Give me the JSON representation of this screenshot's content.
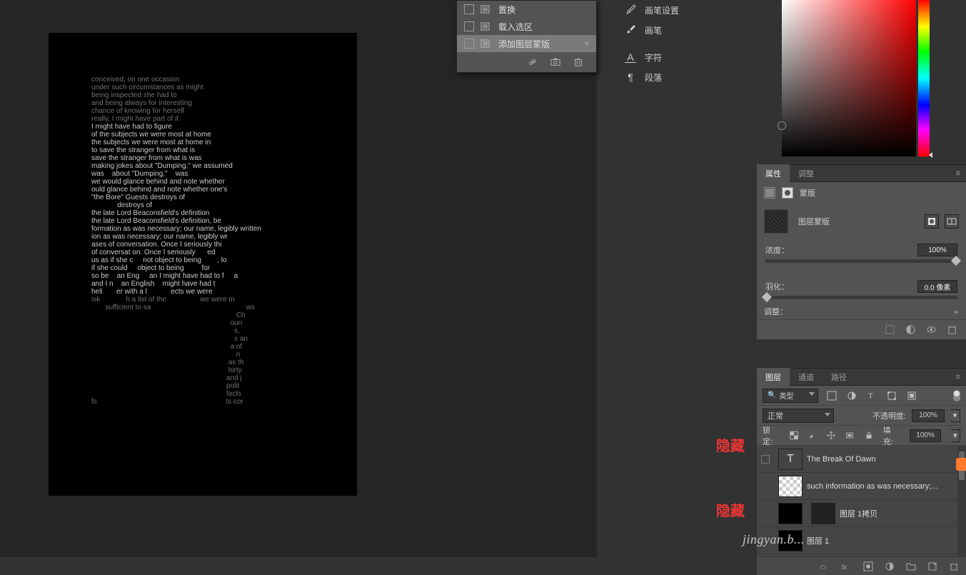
{
  "context_menu": {
    "items": [
      {
        "label": "置换"
      },
      {
        "label": "载入选区"
      },
      {
        "label": "添加图层蒙版"
      }
    ]
  },
  "right_list": {
    "items": [
      {
        "icon": "brush-settings",
        "label": "画笔设置"
      },
      {
        "icon": "brush",
        "label": "画笔"
      },
      {
        "icon": "character",
        "label": "字符"
      },
      {
        "icon": "paragraph",
        "label": "段落"
      }
    ]
  },
  "props": {
    "tabs": {
      "a": "属性",
      "b": "调整"
    },
    "mask_label": "蒙版",
    "mask_title": "图层蒙版",
    "density_label": "浓度：",
    "density_value": "100%",
    "feather_label": "羽化：",
    "feather_value": "0.0 像素",
    "refine_label": "调整："
  },
  "layers_panel": {
    "tabs": {
      "a": "图层",
      "b": "通道",
      "c": "路径"
    },
    "kind": "类型",
    "blend_mode": "正常",
    "opacity_label": "不透明度:",
    "opacity_value": "100%",
    "lock_label": "锁定:",
    "fill_label": "填充:",
    "fill_value": "100%",
    "layers": [
      {
        "name": "The Break Of Dawn",
        "type": "text"
      },
      {
        "name": "such information as was necessary;...",
        "type": "raster",
        "checker": true
      },
      {
        "name": "图层 1拷贝",
        "type": "raster"
      },
      {
        "name": "图层 1",
        "type": "smart"
      }
    ]
  },
  "annotations": {
    "hide1": "隐藏",
    "hide2": "隐藏"
  },
  "watermark": {
    "small": "jingyan.b...",
    "big": ""
  }
}
